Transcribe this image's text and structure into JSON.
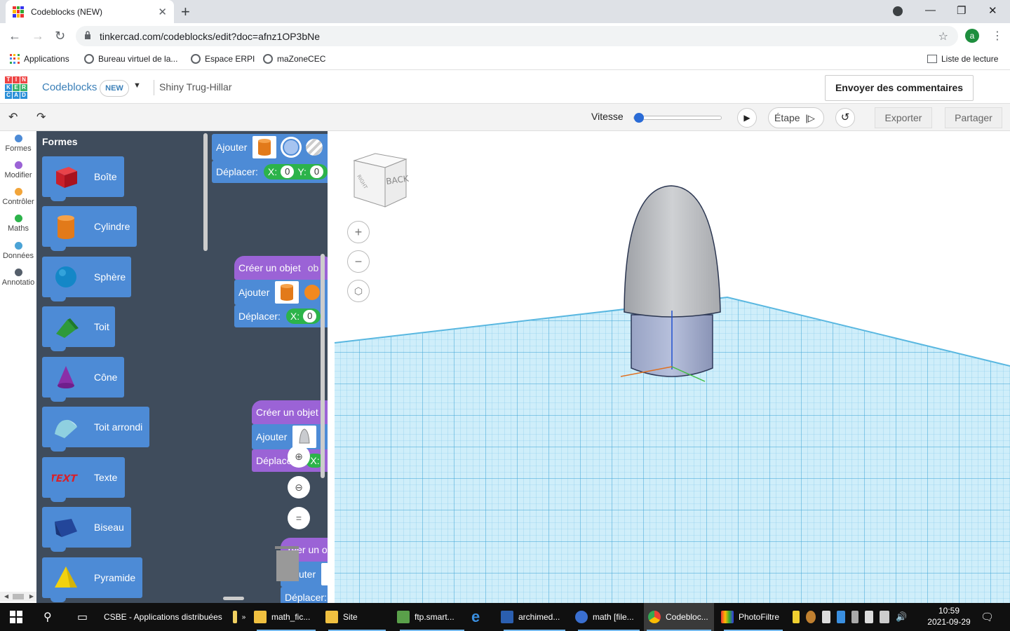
{
  "browser": {
    "tab_title": "Codeblocks (NEW)",
    "url": "tinkercad.com/codeblocks/edit?doc=afnz1OP3bNe",
    "avatar_letter": "a",
    "bookmarks": [
      "Applications",
      "Bureau virtuel de la...",
      "Espace ERPI",
      "maZoneCEC"
    ],
    "reading_list": "Liste de lecture"
  },
  "header": {
    "app_name": "Codeblocks",
    "new_badge": "NEW",
    "doc_name": "Shiny Trug-Hillar",
    "feedback_label": "Envoyer des commentaires"
  },
  "toolbar": {
    "speed_label": "Vitesse",
    "speed_value": 0.0,
    "step_label": "Étape",
    "export_label": "Exporter",
    "share_label": "Partager"
  },
  "categories": [
    {
      "label": "Formes",
      "color": "#4d8bd6"
    },
    {
      "label": "Modifier",
      "color": "#9b63d6"
    },
    {
      "label": "Contrôler",
      "color": "#f2a53a"
    },
    {
      "label": "Maths",
      "color": "#2cb34a"
    },
    {
      "label": "Données",
      "color": "#4ba3d6"
    },
    {
      "label": "Annotatio",
      "color": "#555f6b"
    }
  ],
  "palette": {
    "title": "Formes",
    "shapes": [
      {
        "label": "Boîte",
        "icon": "box-icon"
      },
      {
        "label": "Cylindre",
        "icon": "cylinder-icon"
      },
      {
        "label": "Sphère",
        "icon": "sphere-icon"
      },
      {
        "label": "Toit",
        "icon": "roof-icon"
      },
      {
        "label": "Cône",
        "icon": "cone-icon"
      },
      {
        "label": "Toit arrondi",
        "icon": "round-roof-icon"
      },
      {
        "label": "Texte",
        "icon": "text-icon"
      },
      {
        "label": "Biseau",
        "icon": "wedge-icon"
      },
      {
        "label": "Pyramide",
        "icon": "pyramid-icon"
      }
    ]
  },
  "workspace": {
    "add_label": "Ajouter",
    "move_label": "Déplacer:",
    "create_label": "Créer un objet",
    "create_suffix": "ob",
    "x_label": "X:",
    "y_label": "Y:",
    "x_value": "0",
    "move_partial": "Déplace",
    "create_partial": "ˆréer un o",
    "add_partial": "uter"
  },
  "viewcube": {
    "face_label": "BACK",
    "side_label": "RIGHT"
  },
  "taskbar": {
    "items": [
      "CSBE - Applications distribuées",
      "math_fic...",
      "Site",
      "ftp.smart...",
      "archimed...",
      "math [file...",
      "Codebloc...",
      "PhotoFiltre"
    ],
    "time": "10:59",
    "date": "2021-09-29"
  },
  "colors": {
    "accent": "#2a6bd6",
    "block_blue": "#4d8bd6",
    "block_purple": "#9b63d6",
    "palette_bg": "#3f4c5c",
    "grid": "#59b7e0"
  }
}
